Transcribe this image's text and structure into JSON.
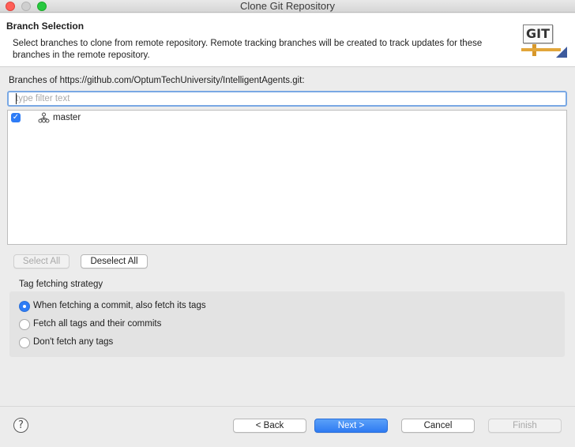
{
  "window": {
    "title": "Clone Git Repository"
  },
  "header": {
    "title": "Branch Selection",
    "description": "Select branches to clone from remote repository. Remote tracking branches will be created to track updates for these branches in the remote repository.",
    "logo_text": "GIT"
  },
  "branches": {
    "label": "Branches of https://github.com/OptumTechUniversity/IntelligentAgents.git:",
    "filter_placeholder": "type filter text",
    "filter_value": "",
    "items": [
      {
        "name": "master",
        "checked": true
      }
    ]
  },
  "selection_buttons": {
    "select_all": "Select All",
    "deselect_all": "Deselect All"
  },
  "tag_fetching": {
    "title": "Tag fetching strategy",
    "options": [
      {
        "label": "When fetching a commit, also fetch its tags",
        "selected": true
      },
      {
        "label": "Fetch all tags and their commits",
        "selected": false
      },
      {
        "label": "Don't fetch any tags",
        "selected": false
      }
    ]
  },
  "footer": {
    "help_symbol": "?",
    "back": "< Back",
    "next": "Next >",
    "cancel": "Cancel",
    "finish": "Finish"
  },
  "colors": {
    "accent": "#2e7cf6",
    "focus_ring": "#79a8e4",
    "close": "#ff5f57",
    "maximize": "#28c840"
  },
  "icons": {
    "branch": "branch-icon",
    "help": "help-icon",
    "check": "checkmark-icon"
  }
}
